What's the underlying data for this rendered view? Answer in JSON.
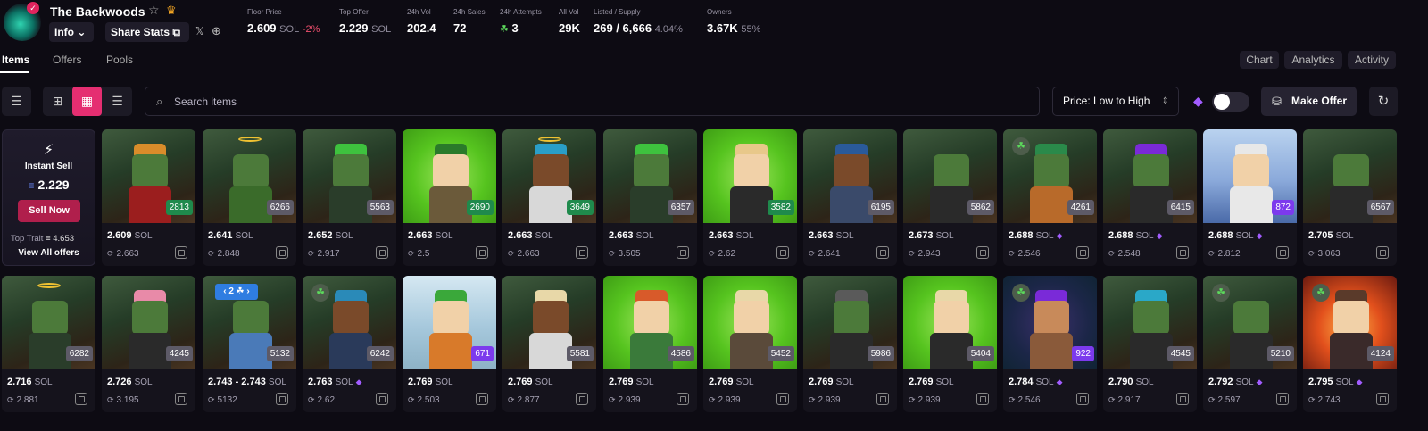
{
  "header": {
    "logo_badge": "✓",
    "title": "The Backwoods",
    "star_icon": "☆",
    "crown_icon": "♛",
    "info_label": "Info ⌄",
    "share_label": "Share Stats ⧉",
    "x_icon": "𝕏",
    "globe_icon": "⊕",
    "stats": {
      "floor_label": "Floor Price",
      "floor_value": "2.609",
      "floor_unit": "SOL",
      "floor_change": "-2%",
      "offer_label": "Top Offer",
      "offer_value": "2.229",
      "offer_unit": "SOL",
      "vol_label": "24h Vol",
      "vol_value": "202.4",
      "sales_label": "24h Sales",
      "sales_value": "72",
      "attempts_label": "24h Attempts",
      "attempts_value": "3",
      "attempts_icon": "☘",
      "allvol_label": "All Vol",
      "allvol_value": "29K",
      "listed_label": "Listed / Supply",
      "listed_value": "269 / 6,666",
      "listed_pct": "4.04%",
      "owners_label": "Owners",
      "owners_value": "3.67K",
      "owners_pct": "55%"
    }
  },
  "tabs": {
    "items": "Items",
    "offers": "Offers",
    "pools": "Pools"
  },
  "right_tabs": {
    "chart": "Chart",
    "analytics": "Analytics",
    "activity": "Activity"
  },
  "toolbar": {
    "filter_icon": "☰",
    "view_grid_large": "⊞",
    "view_grid_small": "▦",
    "view_list": "☰",
    "search_icon": "⌕",
    "search_placeholder": "Search items",
    "sort_label": "Price: Low to High",
    "sort_chevron": "⇕",
    "gem_icon": "◆",
    "make_offer_icon": "⛁",
    "make_offer_label": "Make Offer",
    "refresh_icon": "↻"
  },
  "instant_sell": {
    "bolt_icon": "⚡",
    "title": "Instant Sell",
    "sol_icon": "≡",
    "price": "2.229",
    "sell_label": "Sell Now",
    "top_trait_label": "Top Trait",
    "top_trait_value": "≡ 4.653",
    "view_all": "View All offers"
  },
  "cards_row1": [
    {
      "price": "2.609",
      "unit": "SOL",
      "gem": false,
      "last": "2.663",
      "rank": "2813",
      "rank_style": "gr",
      "bg": "cave",
      "skin": "#4c7a3a",
      "body": "#9b1e1e",
      "hat": "#d98c2a",
      "halo": false,
      "clover": false
    },
    {
      "price": "2.641",
      "unit": "SOL",
      "gem": false,
      "last": "2.848",
      "rank": "6266",
      "rank_style": "",
      "bg": "cave",
      "skin": "#4c7a3a",
      "body": "#3a6b2a",
      "hat": "",
      "halo": true,
      "clover": false
    },
    {
      "price": "2.652",
      "unit": "SOL",
      "gem": false,
      "last": "2.917",
      "rank": "5563",
      "rank_style": "",
      "bg": "cave",
      "skin": "#4c7a3a",
      "body": "#2a3d2a",
      "hat": "#3ec23e",
      "halo": false,
      "clover": false
    },
    {
      "price": "2.663",
      "unit": "SOL",
      "gem": false,
      "last": "2.5",
      "rank": "2690",
      "rank_style": "gr",
      "bg": "green",
      "skin": "#f1d1a8",
      "body": "#6b5a3a",
      "hat": "#2a7a2a",
      "halo": false,
      "clover": false
    },
    {
      "price": "2.663",
      "unit": "SOL",
      "gem": false,
      "last": "2.663",
      "rank": "3649",
      "rank_style": "gr",
      "bg": "cave",
      "skin": "#7a4a2a",
      "body": "#d8d8d8",
      "hat": "#2a9ec8",
      "halo": true,
      "clover": false
    },
    {
      "price": "2.663",
      "unit": "SOL",
      "gem": false,
      "last": "3.505",
      "rank": "6357",
      "rank_style": "",
      "bg": "cave",
      "skin": "#4c7a3a",
      "body": "#2a3d2a",
      "hat": "#3ec23e",
      "halo": false,
      "clover": false
    },
    {
      "price": "2.663",
      "unit": "SOL",
      "gem": false,
      "last": "2.62",
      "rank": "3582",
      "rank_style": "gr",
      "bg": "green",
      "skin": "#f1d1a8",
      "body": "#2a2a2a",
      "hat": "#e8c88a",
      "halo": false,
      "clover": false
    },
    {
      "price": "2.663",
      "unit": "SOL",
      "gem": false,
      "last": "2.641",
      "rank": "6195",
      "rank_style": "",
      "bg": "cave",
      "skin": "#7a4a2a",
      "body": "#3a4a6a",
      "hat": "#2a5a9a",
      "halo": false,
      "clover": false
    },
    {
      "price": "2.673",
      "unit": "SOL",
      "gem": false,
      "last": "2.943",
      "rank": "5862",
      "rank_style": "",
      "bg": "cave",
      "skin": "#4c7a3a",
      "body": "#2a2a2a",
      "hat": "",
      "halo": false,
      "clover": false
    },
    {
      "price": "2.688",
      "unit": "SOL",
      "gem": true,
      "last": "2.546",
      "rank": "4261",
      "rank_style": "",
      "bg": "cave",
      "skin": "#4c7a3a",
      "body": "#b86a2a",
      "hat": "#2a8a4a",
      "halo": false,
      "clover": true
    },
    {
      "price": "2.688",
      "unit": "SOL",
      "gem": true,
      "last": "2.548",
      "rank": "6415",
      "rank_style": "",
      "bg": "cave",
      "skin": "#4c7a3a",
      "body": "#2a2a2a",
      "hat": "#7a2ad8",
      "halo": false,
      "clover": false
    },
    {
      "price": "2.688",
      "unit": "SOL",
      "gem": true,
      "last": "2.812",
      "rank": "872",
      "rank_style": "pu",
      "bg": "blue",
      "skin": "#f1d1a8",
      "body": "#e8e8e8",
      "hat": "#e8e8e8",
      "halo": false,
      "clover": false
    },
    {
      "price": "2.705",
      "unit": "SOL",
      "gem": false,
      "last": "3.063",
      "rank": "6567",
      "rank_style": "",
      "bg": "cave",
      "skin": "#4c7a3a",
      "body": "#2a2a2a",
      "hat": "",
      "halo": false,
      "clover": false
    }
  ],
  "cards_row2": [
    {
      "price": "2.716",
      "unit": "SOL",
      "gem": false,
      "last": "2.881",
      "rank": "6282",
      "rank_style": "",
      "bg": "cave",
      "skin": "#4c7a3a",
      "body": "#2a3d2a",
      "hat": "",
      "halo": true,
      "clover": false
    },
    {
      "price": "2.726",
      "unit": "SOL",
      "gem": false,
      "last": "3.195",
      "rank": "4245",
      "rank_style": "",
      "bg": "cave",
      "skin": "#4c7a3a",
      "body": "#2a2a2a",
      "hat": "#e88aa8",
      "halo": false,
      "clover": false
    },
    {
      "price": "2.743 - 2.743",
      "unit": "SOL",
      "gem": false,
      "last": "5132",
      "rank": "5132",
      "rank_style": "",
      "bg": "cave",
      "skin": "#4c7a3a",
      "body": "#4a7ab8",
      "hat": "",
      "halo": false,
      "clover": false,
      "multi": "‹ 2 ☘ ›"
    },
    {
      "price": "2.763",
      "unit": "SOL",
      "gem": true,
      "last": "2.62",
      "rank": "6242",
      "rank_style": "",
      "bg": "cave",
      "skin": "#7a4a2a",
      "body": "#2a3a5a",
      "hat": "#2a8ab8",
      "halo": false,
      "clover": true
    },
    {
      "price": "2.769",
      "unit": "SOL",
      "gem": false,
      "last": "2.503",
      "rank": "671",
      "rank_style": "pu",
      "bg": "snow",
      "skin": "#f1d1a8",
      "body": "#d87a2a",
      "hat": "#3aa83a",
      "halo": false,
      "clover": false
    },
    {
      "price": "2.769",
      "unit": "SOL",
      "gem": false,
      "last": "2.877",
      "rank": "5581",
      "rank_style": "",
      "bg": "cave",
      "skin": "#7a4a2a",
      "body": "#d8d8d8",
      "hat": "#e8d8a8",
      "halo": false,
      "clover": false
    },
    {
      "price": "2.769",
      "unit": "SOL",
      "gem": false,
      "last": "2.939",
      "rank": "4586",
      "rank_style": "",
      "bg": "green",
      "skin": "#f1d1a8",
      "body": "#3a7a3a",
      "hat": "#d85a2a",
      "halo": false,
      "clover": false
    },
    {
      "price": "2.769",
      "unit": "SOL",
      "gem": false,
      "last": "2.939",
      "rank": "5452",
      "rank_style": "",
      "bg": "green",
      "skin": "#f1d1a8",
      "body": "#5a4a3a",
      "hat": "#e8d8a8",
      "halo": false,
      "clover": false
    },
    {
      "price": "2.769",
      "unit": "SOL",
      "gem": false,
      "last": "2.939",
      "rank": "5986",
      "rank_style": "",
      "bg": "cave",
      "skin": "#4c7a3a",
      "body": "#2a2a2a",
      "hat": "#5a5a5a",
      "halo": false,
      "clover": false
    },
    {
      "price": "2.769",
      "unit": "SOL",
      "gem": false,
      "last": "2.939",
      "rank": "5404",
      "rank_style": "",
      "bg": "green",
      "skin": "#f1d1a8",
      "body": "#2a2a2a",
      "hat": "#e8d8a8",
      "halo": false,
      "clover": false
    },
    {
      "price": "2.784",
      "unit": "SOL",
      "gem": true,
      "last": "2.546",
      "rank": "922",
      "rank_style": "pu",
      "bg": "crystal",
      "skin": "#c88a5a",
      "body": "#8a5a3a",
      "hat": "#7a2ad8",
      "halo": false,
      "clover": true
    },
    {
      "price": "2.790",
      "unit": "SOL",
      "gem": false,
      "last": "2.917",
      "rank": "4545",
      "rank_style": "",
      "bg": "cave",
      "skin": "#4c7a3a",
      "body": "#2a2a2a",
      "hat": "#2aa8c8",
      "halo": false,
      "clover": false
    },
    {
      "price": "2.792",
      "unit": "SOL",
      "gem": true,
      "last": "2.597",
      "rank": "5210",
      "rank_style": "",
      "bg": "cave",
      "skin": "#4c7a3a",
      "body": "#2a2a2a",
      "hat": "",
      "halo": false,
      "clover": true
    },
    {
      "price": "2.795",
      "unit": "SOL",
      "gem": true,
      "last": "2.743",
      "rank": "4124",
      "rank_style": "",
      "bg": "fire",
      "skin": "#f1d1a8",
      "body": "#3a2a2a",
      "hat": "#5a3a2a",
      "halo": false,
      "clover": true
    }
  ],
  "card_icons": {
    "last_sale_icon": "⟳",
    "select_icon": "select-square",
    "gem_icon": "◆",
    "clover_icon": "☘"
  },
  "colors": {
    "accent": "#e52e71",
    "sell_now": "#b01f4c",
    "green_rank": "#1f8a4c",
    "purple_rank": "#7c3aed",
    "background": "#0d0b13"
  }
}
